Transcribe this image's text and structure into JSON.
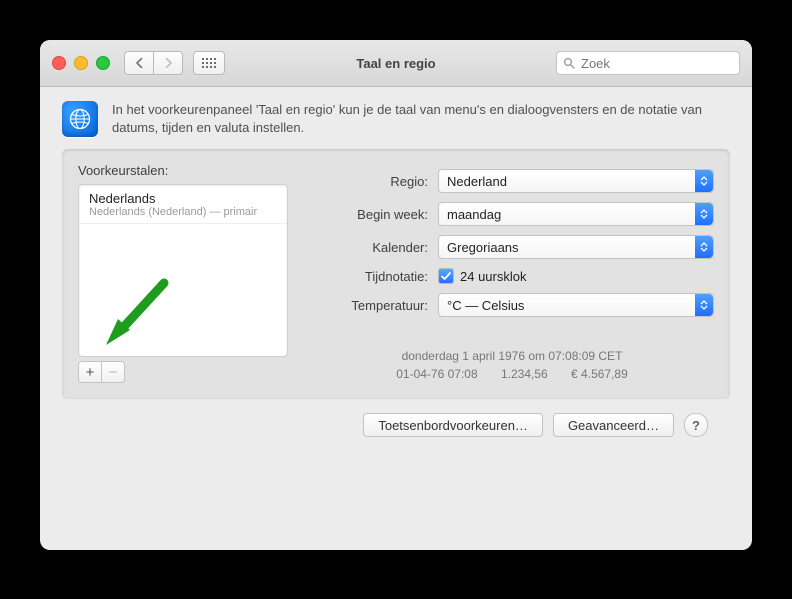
{
  "window": {
    "title": "Taal en regio",
    "search_placeholder": "Zoek"
  },
  "intro": "In het voorkeurenpaneel 'Taal en regio' kun je de taal van menu's en dialoogvensters en de notatie van datums, tijden en valuta instellen.",
  "languages": {
    "label": "Voorkeurstalen:",
    "items": [
      {
        "name": "Nederlands",
        "sub": "Nederlands (Nederland) — primair"
      }
    ]
  },
  "form": {
    "region_label": "Regio:",
    "region_value": "Nederland",
    "week_label": "Begin week:",
    "week_value": "maandag",
    "calendar_label": "Kalender:",
    "calendar_value": "Gregoriaans",
    "timefmt_label": "Tijdnotatie:",
    "timefmt_check": "24 uursklok",
    "temp_label": "Temperatuur:",
    "temp_value": "°C — Celsius"
  },
  "examples": {
    "line1": "donderdag 1 april 1976 om 07:08:09 CET",
    "date": "01-04-76 07:08",
    "number": "1.234,56",
    "currency": "€ 4.567,89"
  },
  "footer": {
    "keyboard": "Toetsenbordvoorkeuren…",
    "advanced": "Geavanceerd…"
  }
}
